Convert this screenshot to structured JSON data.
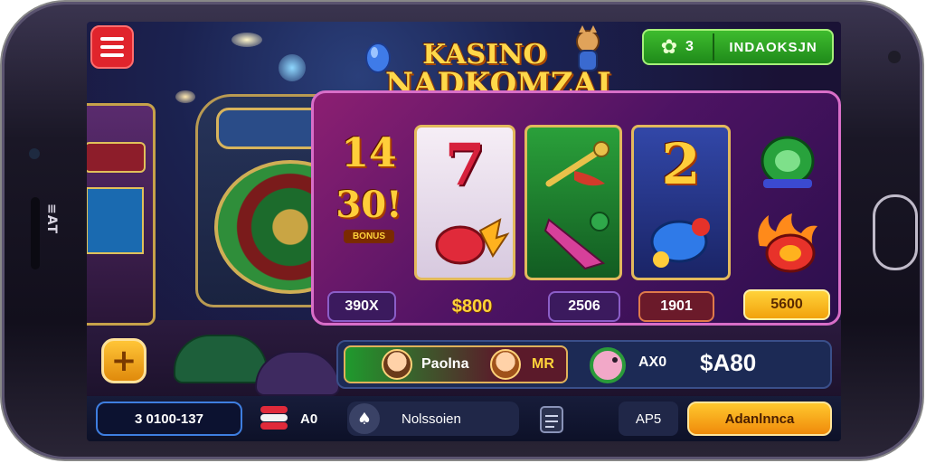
{
  "header": {
    "logo_line1": "KASINO",
    "logo_line2": "NADKOMZAI",
    "top_pill_count": "3",
    "top_pill_label": "INDAOKSJN"
  },
  "slot": {
    "left_numbers": [
      "14",
      "30!"
    ],
    "left_small_label": "BONUS",
    "reel_symbols": [
      "7",
      "2"
    ],
    "reel_values": [
      "390X",
      "$800",
      "2506",
      "1901",
      "5600"
    ]
  },
  "win_row": {
    "player_name": "Paolna",
    "player_tag": "MR",
    "multiplier": "AX0",
    "amount": "$A80"
  },
  "bottom_bar": {
    "balance": "3 0100-137",
    "chips_label": "A0",
    "mission_label": "Nolssoien",
    "ap_label": "AP5",
    "action_button": "Adanlnnca"
  },
  "icons": {
    "menu": "hamburger-menu-icon",
    "gear": "gear-icon",
    "plus": "plus-icon",
    "chips": "casino-chips-icon",
    "spade": "spade-icon",
    "clipboard": "clipboard-icon"
  },
  "colors": {
    "accent_orange": "#ffb21e",
    "menu_red": "#e0242c",
    "pill_green": "#2aa324",
    "value_gold": "#ffd33a"
  }
}
